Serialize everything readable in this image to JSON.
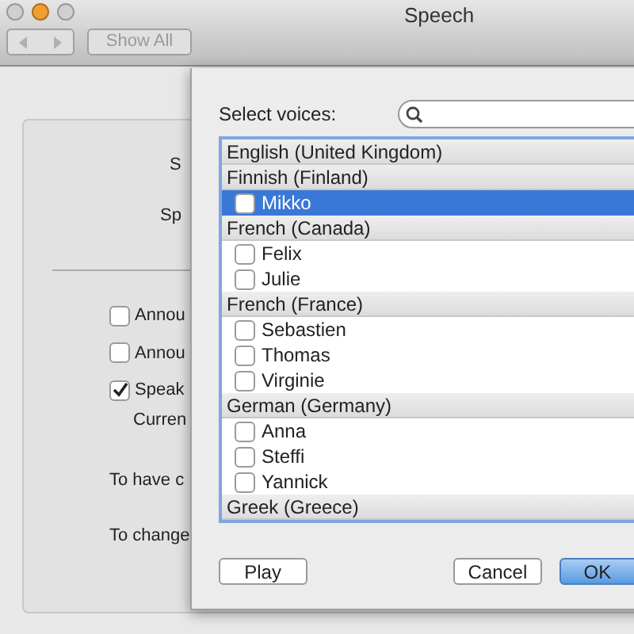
{
  "window": {
    "title": "Speech"
  },
  "toolbar": {
    "show_all": "Show All"
  },
  "background_panel": {
    "labels": [
      "S",
      "Sp"
    ],
    "options": [
      {
        "label": "Annou",
        "checked": false
      },
      {
        "label": "Annou",
        "checked": false
      },
      {
        "label": "Speak",
        "checked": true
      }
    ],
    "sub_label": "Curren",
    "notes": [
      "To have c",
      "To change"
    ]
  },
  "sheet": {
    "label": "Select voices:",
    "groups": [
      {
        "name": "English (United Kingdom)"
      },
      {
        "name": "Finnish (Finland)",
        "voices": [
          {
            "name": "Mikko",
            "checked": false,
            "selected": true
          }
        ]
      },
      {
        "name": "French (Canada)",
        "voices": [
          {
            "name": "Felix",
            "checked": false,
            "selected": false
          },
          {
            "name": "Julie",
            "checked": false,
            "selected": false
          }
        ]
      },
      {
        "name": "French (France)",
        "voices": [
          {
            "name": "Sebastien",
            "checked": false,
            "selected": false
          },
          {
            "name": "Thomas",
            "checked": false,
            "selected": false
          },
          {
            "name": "Virginie",
            "checked": false,
            "selected": false
          }
        ]
      },
      {
        "name": "German (Germany)",
        "voices": [
          {
            "name": "Anna",
            "checked": false,
            "selected": false
          },
          {
            "name": "Steffi",
            "checked": false,
            "selected": false
          },
          {
            "name": "Yannick",
            "checked": false,
            "selected": false
          }
        ]
      },
      {
        "name": "Greek (Greece)"
      }
    ],
    "buttons": {
      "play": "Play",
      "cancel": "Cancel",
      "ok": "OK"
    }
  }
}
